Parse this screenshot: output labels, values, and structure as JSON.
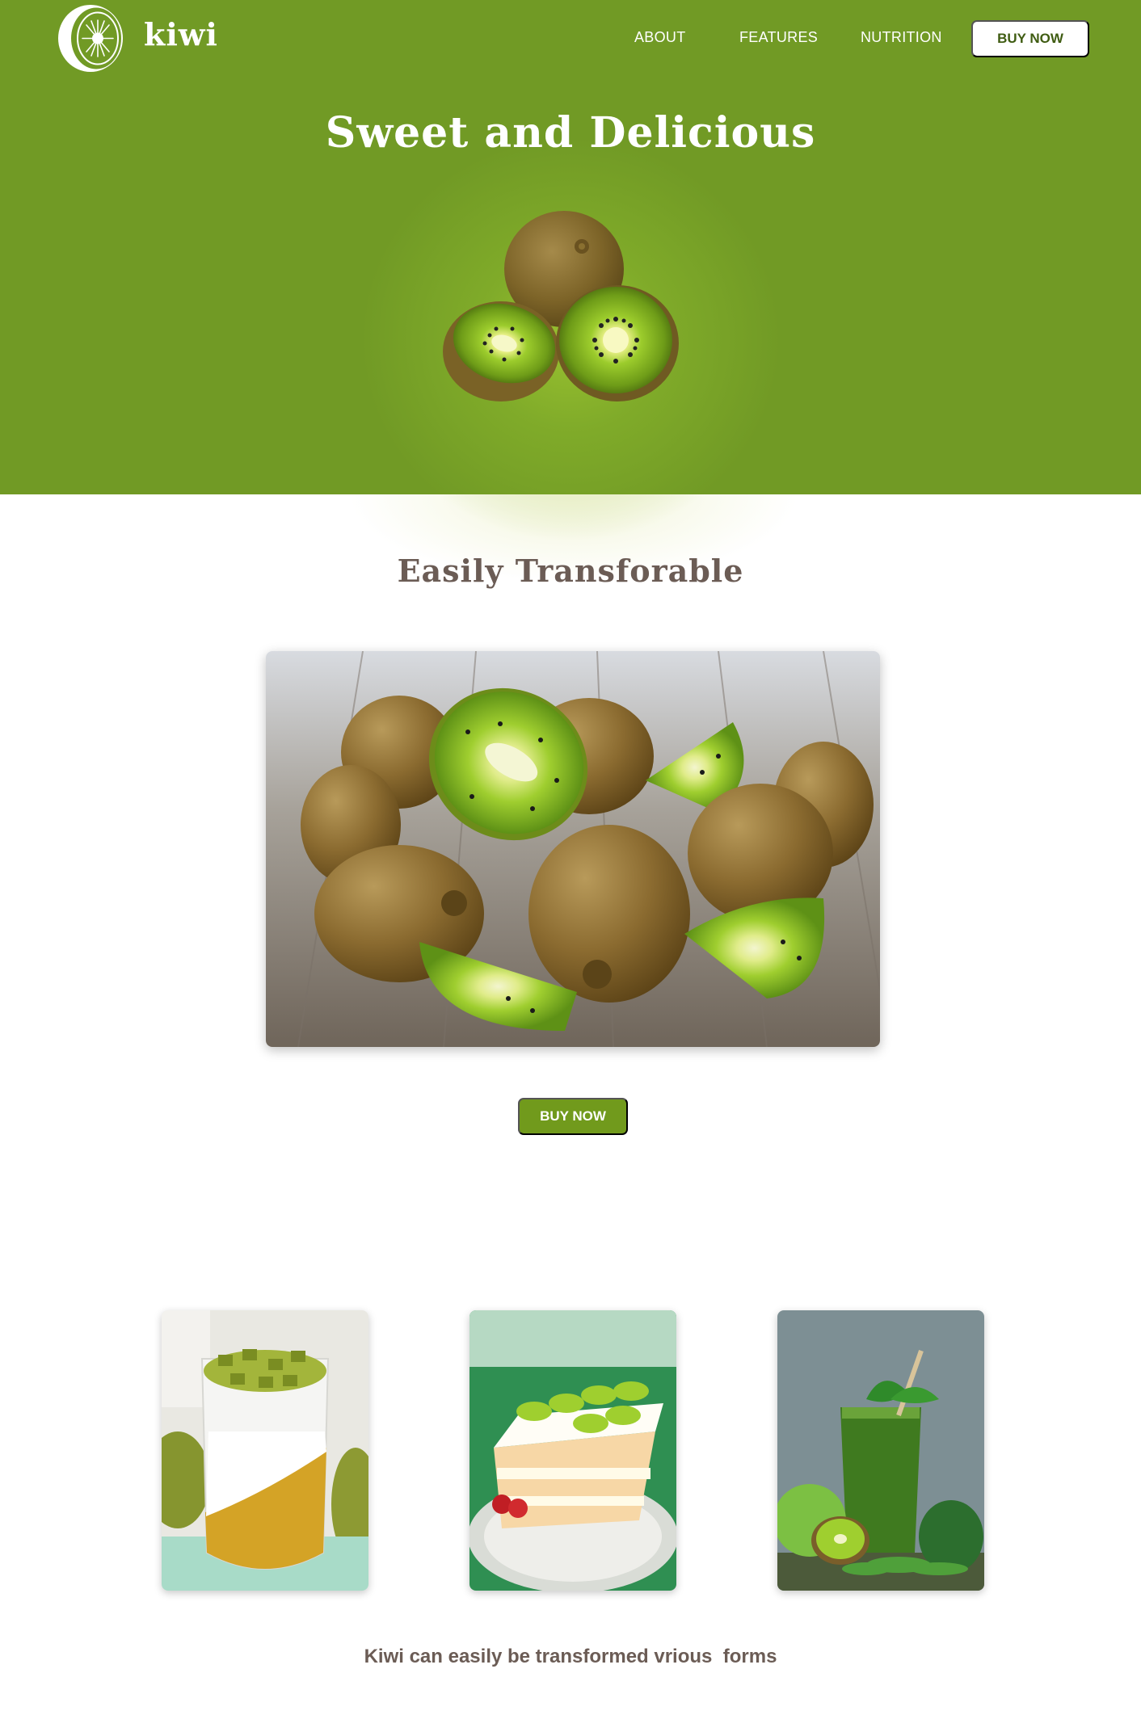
{
  "header": {
    "brand": "kiwi",
    "logo_icon": "kiwi-slice-logo",
    "nav": [
      {
        "label": "ABOUT"
      },
      {
        "label": "FEATURES"
      },
      {
        "label": "NUTRITION"
      }
    ],
    "buy_label": "BUY NOW"
  },
  "hero": {
    "title": "Sweet and Delicious",
    "image": "kiwi-fruits-halves"
  },
  "transform_section": {
    "title": "Easily Transforable",
    "image": "kiwis-on-wooden-table",
    "buy_label": "BUY NOW"
  },
  "gallery": {
    "items": [
      {
        "image": "kiwi-parfait-glass"
      },
      {
        "image": "kiwi-cake-slice"
      },
      {
        "image": "green-kiwi-smoothie"
      }
    ],
    "caption": "Kiwi can easily be transformed vrious  forms"
  },
  "colors": {
    "hero_green": "#719a25",
    "button_green": "#719a1c",
    "heading_brown": "#6b5c55",
    "white": "#ffffff"
  }
}
